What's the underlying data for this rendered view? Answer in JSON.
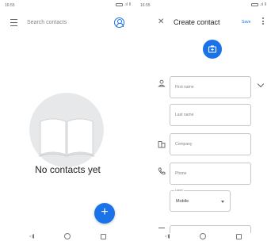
{
  "left": {
    "status": {
      "time": "16:55",
      "indicators": "▐▐▐ ·.∣ ǁ"
    },
    "search": {
      "placeholder": "Search contacts",
      "menu_icon": "hamburger-icon",
      "account_icon": "account-circle-icon"
    },
    "empty": {
      "icon": "open-book-icon",
      "message": "No contacts yet"
    },
    "fab": {
      "glyph": "+",
      "icon": "add-icon"
    },
    "nav": {
      "back_icon": "back-icon",
      "home_icon": "home-icon",
      "recent_icon": "recent-apps-icon"
    }
  },
  "right": {
    "status": {
      "time": "16:55",
      "indicators": "▐▐▐ ·.∣ ǁ"
    },
    "header": {
      "close_glyph": "✕",
      "title": "Create contact",
      "save_label": "Save",
      "more_icon": "more-vert-icon"
    },
    "photo": {
      "icon": "add-photo-icon"
    },
    "fields": {
      "first_name": "First name",
      "last_name": "Last name",
      "company": "Company",
      "phone": "Phone"
    },
    "phone_label": {
      "title": "Label",
      "value": "Mobile"
    },
    "icons": {
      "person": "person-icon",
      "company": "business-icon",
      "phone": "phone-icon",
      "expand": "chevron-down-icon"
    },
    "nav": {
      "back_icon": "back-icon",
      "home_icon": "home-icon",
      "recent_icon": "recent-apps-icon"
    }
  },
  "colors": {
    "accent": "#1a73e8",
    "empty_circle": "#e7e8ea",
    "field_border": "#c4c7c5"
  }
}
